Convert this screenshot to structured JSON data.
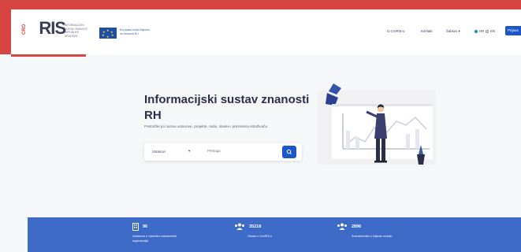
{
  "header": {
    "logo_prefix": "CRO",
    "logo_text": "RIS",
    "logo_subtitle": "INFORMACIJSKI SUSTAV ZNANOSTI REPUBLIKE HRVATSKE",
    "eu_text": "Europska unija Zajedno do fondova EU",
    "nav": [
      "O CroRIS-u",
      "Kontakt",
      "Šabloni ▾"
    ],
    "lang_hr": "HR",
    "lang_en": "EN",
    "login_label": "Prijava"
  },
  "hero": {
    "title": "Informacijski sustav znanosti RH",
    "description": "Pretražite po nazivu ustanove, projekte, radio, stavke i prezimenu istraživača",
    "search_select": "Ustanovi",
    "search_placeholder": "Pretraga"
  },
  "stats": [
    {
      "value": "96",
      "label": "Ustanova u Upisniku znanstvenih organizacija"
    },
    {
      "value": "35218",
      "label": "Osoba u CroRIS-u"
    },
    {
      "value": "2896",
      "label": "Znanstvenika u trajnom zvanju"
    }
  ],
  "colors": {
    "brand_red": "#d64541",
    "primary_blue": "#1b57c9",
    "stats_bar": "#3f6bc8"
  }
}
